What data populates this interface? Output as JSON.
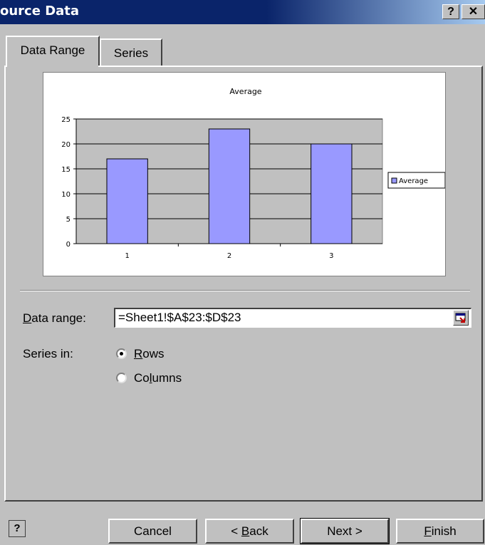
{
  "window": {
    "title": "ource Data",
    "help_label": "?",
    "close_label": "✕"
  },
  "tabs": [
    {
      "label": "Data Range",
      "active": true
    },
    {
      "label": "Series",
      "active": false
    }
  ],
  "chart_data": {
    "type": "bar",
    "title": "Average",
    "categories": [
      "1",
      "2",
      "3"
    ],
    "series": [
      {
        "name": "Average",
        "values": [
          17,
          23,
          20
        ],
        "color": "#9999ff"
      }
    ],
    "ylim": [
      0,
      25
    ],
    "yticks": [
      "0",
      "5",
      "10",
      "15",
      "20",
      "25"
    ],
    "grid": true,
    "legend": "right",
    "plot_bg": "#c0c0c0"
  },
  "data_range": {
    "label_first": "D",
    "label_rest": "ata range:",
    "value": "=Sheet1!$A$23:$D$23"
  },
  "series_in": {
    "label": "Series in:",
    "rows_first": "R",
    "rows_rest": "ows",
    "columns_pre": "Co",
    "columns_u": "l",
    "columns_post": "umns",
    "selected": "Rows"
  },
  "buttons": {
    "cancel": "Cancel",
    "back_pre": "< ",
    "back_u": "B",
    "back_post": "ack",
    "next": "Next >",
    "finish_u": "F",
    "finish_post": "inish",
    "help_icon": "?"
  }
}
